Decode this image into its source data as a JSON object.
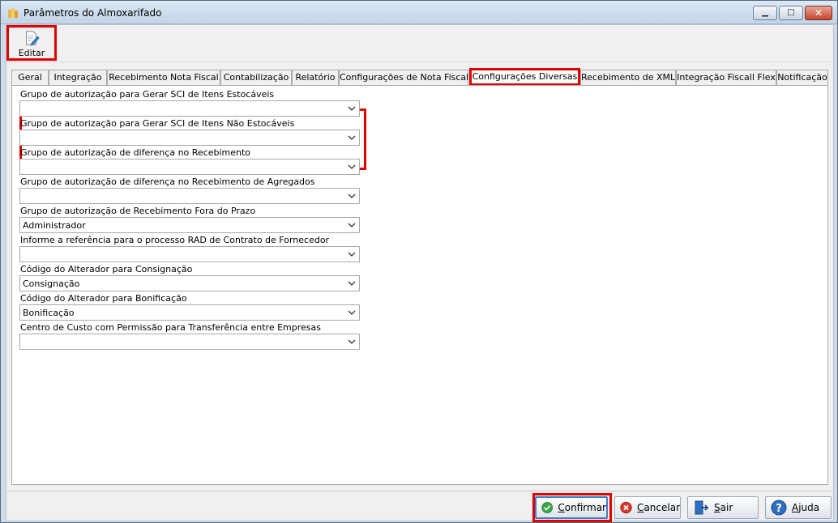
{
  "window": {
    "title": "Parâmetros do Almoxarifado",
    "minimize_glyph": "▁",
    "maximize_glyph": "□",
    "close_glyph": "✕"
  },
  "toolbar": {
    "edit_label": "Editar",
    "edit_icon": "edit-document-icon"
  },
  "tabs": [
    {
      "label": "Geral"
    },
    {
      "label": "Integração"
    },
    {
      "label": "Recebimento Nota Fiscal"
    },
    {
      "label": "Contabilização"
    },
    {
      "label": "Relatório"
    },
    {
      "label": "Configurações de Nota Fiscal"
    },
    {
      "label": "Configurações Diversas",
      "active": true
    },
    {
      "label": "Recebimento de XML"
    },
    {
      "label": "Integração Fiscall Flex"
    },
    {
      "label": "Notificação"
    }
  ],
  "fields": [
    {
      "label": "Grupo de autorização para Gerar SCI de Itens Estocáveis",
      "value": ""
    },
    {
      "label": "Grupo de autorização para Gerar SCI de Itens Não Estocáveis",
      "value": ""
    },
    {
      "label": "Grupo de autorização de diferença no Recebimento",
      "value": ""
    },
    {
      "label": "Grupo de autorização de diferença no Recebimento de Agregados",
      "value": ""
    },
    {
      "label": "Grupo de autorização de Recebimento Fora do Prazo",
      "value": "Administrador"
    },
    {
      "label": "Informe a referência para o processo RAD de Contrato de Fornecedor",
      "value": ""
    },
    {
      "label": "Código do Alterador para Consignação",
      "value": "Consignação"
    },
    {
      "label": "Código do Alterador para Bonificação",
      "value": "Bonificação"
    },
    {
      "label": "Centro de Custo com Permissão para Transferência entre Empresas",
      "value": ""
    }
  ],
  "buttons": {
    "confirm": {
      "label_u": "C",
      "label_rest": "onfirmar",
      "icon": "check-circle-icon",
      "color": "#3aa64a"
    },
    "cancel": {
      "label_u": "C",
      "label_rest": "ancelar",
      "icon": "cancel-circle-icon",
      "color": "#d9342b"
    },
    "exit": {
      "label_u": "S",
      "label_rest": "air",
      "icon": "exit-door-icon",
      "color": "#2f6fbf"
    },
    "help": {
      "label_u": "A",
      "label_rest": "juda",
      "icon": "help-circle-icon",
      "color": "#2f6fbf"
    }
  }
}
